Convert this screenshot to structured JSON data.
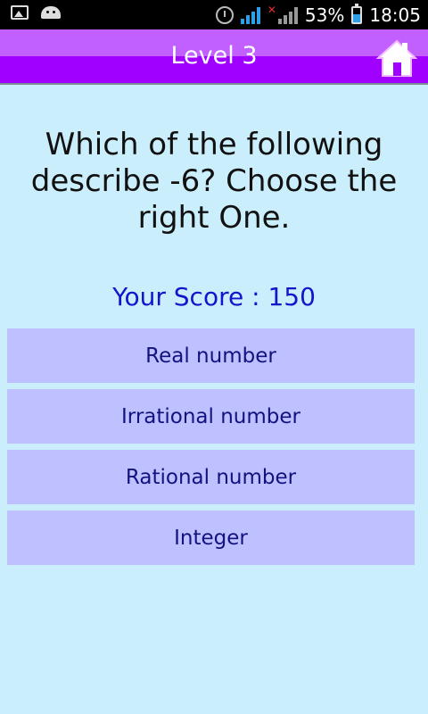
{
  "status_bar": {
    "battery": "53%",
    "time": "18:05",
    "icons": [
      "image-icon",
      "android-icon",
      "alarm-icon",
      "signal-icon",
      "signal-off-icon",
      "battery-charging-icon"
    ]
  },
  "header": {
    "title": "Level 3",
    "home_icon": "home-icon",
    "colors": {
      "top": "#c160ff",
      "bottom": "#a000ff"
    }
  },
  "question": {
    "text": "Which of the following describe -6? Choose the right One."
  },
  "score": {
    "text": "Your Score : 150"
  },
  "answers": [
    {
      "label": "Real number"
    },
    {
      "label": "Irrational number"
    },
    {
      "label": "Rational number"
    },
    {
      "label": "Integer"
    }
  ],
  "colors": {
    "background": "#cbeefc",
    "answer_bg": "#bfc0ff",
    "answer_text": "#131380",
    "score_text": "#1414cc"
  }
}
